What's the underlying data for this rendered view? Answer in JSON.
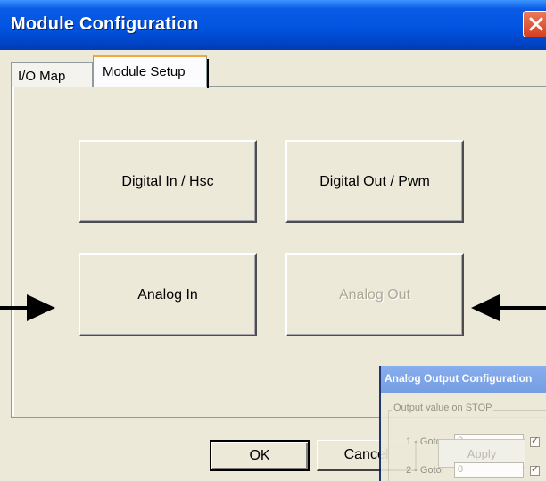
{
  "window": {
    "title": "Module Configuration"
  },
  "tabs": [
    {
      "label": "I/O Map",
      "active": false
    },
    {
      "label": "Module Setup",
      "active": true
    }
  ],
  "module_buttons": [
    {
      "label": "Digital In / Hsc",
      "enabled": true
    },
    {
      "label": "Digital Out / Pwm",
      "enabled": true
    },
    {
      "label": "Analog In",
      "enabled": true
    },
    {
      "label": "Analog Out",
      "enabled": false
    }
  ],
  "dialog_buttons": {
    "ok_label": "OK",
    "cancel_label": "Cancel"
  },
  "overlay": {
    "title": "Analog Output Configuration",
    "group_label": "Output value on STOP",
    "rows": [
      {
        "label": "1 - Goto:",
        "value": "0"
      },
      {
        "label": "2 - Goto:",
        "value": "0"
      }
    ],
    "apply_label": "Apply"
  },
  "icons": {
    "close": "close-icon",
    "left_arrow": "arrow-right-icon",
    "right_arrow": "arrow-left-icon"
  },
  "colors": {
    "titlebar": "#0055e0",
    "close_button": "#d5401f",
    "active_tab_accent": "#f6a73c",
    "window_face": "#ece9d8"
  }
}
